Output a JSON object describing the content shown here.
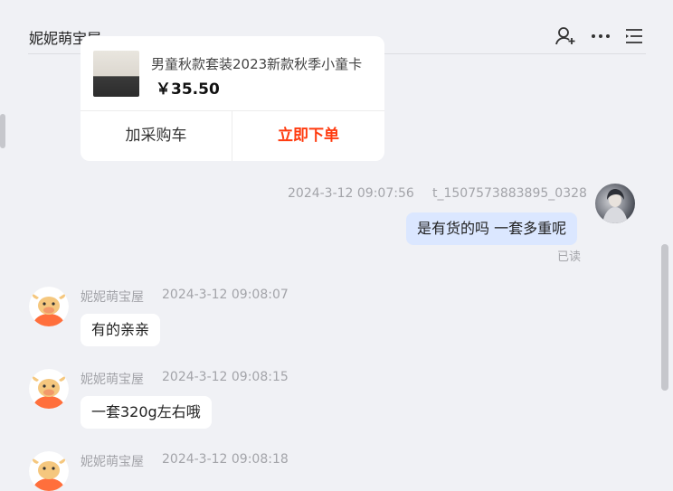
{
  "header": {
    "title": "妮妮萌宝屋"
  },
  "product_card": {
    "title": "男童秋款套装2023新款秋季小童卡",
    "price": "￥35.50",
    "cart_label": "加采购车",
    "order_label": "立即下单"
  },
  "messages": [
    {
      "sender": "t_1507573883895_0328",
      "time": "2024-3-12 09:07:56",
      "text": "是有货的吗 一套多重呢",
      "status": "已读"
    },
    {
      "sender": "妮妮萌宝屋",
      "time": "2024-3-12 09:08:07",
      "text": "有的亲亲"
    },
    {
      "sender": "妮妮萌宝屋",
      "time": "2024-3-12 09:08:15",
      "text": "一套320g左右哦"
    },
    {
      "sender": "妮妮萌宝屋",
      "time": "2024-3-12 09:08:18"
    }
  ],
  "colors": {
    "background": "#f0f1f5",
    "self_bubble": "#dbe7ff",
    "accent_order": "#ff3b0f",
    "shop_avatar": "#ff6f3c"
  },
  "icons": [
    "add-contact-icon",
    "more-icon",
    "menu-list-icon",
    "shop-avatar-bull-icon"
  ]
}
